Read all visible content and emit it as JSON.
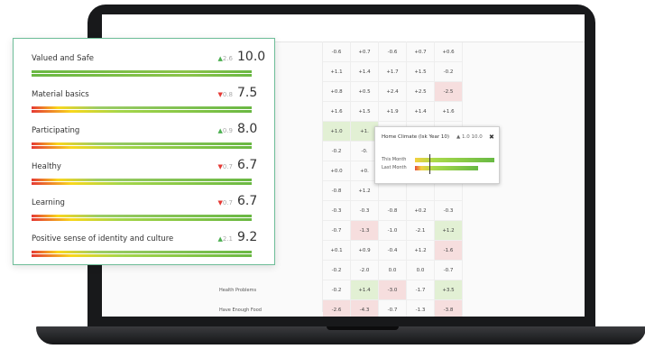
{
  "metrics": [
    {
      "label": "Valued and Safe",
      "direction": "up",
      "delta": "2.6",
      "value": "10.0"
    },
    {
      "label": "Material basics",
      "direction": "down",
      "delta": "0.8",
      "value": "7.5"
    },
    {
      "label": "Participating",
      "direction": "up",
      "delta": "0.9",
      "value": "8.0"
    },
    {
      "label": "Healthy",
      "direction": "down",
      "delta": "0.7",
      "value": "6.7"
    },
    {
      "label": "Learning",
      "direction": "down",
      "delta": "0.7",
      "value": "6.7"
    },
    {
      "label": "Positive sense of identity and culture",
      "direction": "up",
      "delta": "2.1",
      "value": "9.2"
    }
  ],
  "arrows": {
    "up": "▲",
    "down": "▼"
  },
  "colors": {
    "up": "#4caf50",
    "down": "#e53935",
    "accent": "#6ebd98"
  },
  "table": {
    "row_labels": [
      "",
      "",
      "ts at School",
      "",
      "",
      "",
      "",
      "",
      "",
      "",
      "",
      "",
      "Health Problems",
      "Have Enough Food"
    ],
    "rows": [
      [
        "-0.6",
        "+0.7",
        "-0.6",
        "+0.7",
        "+0.6"
      ],
      [
        "+1.1",
        "+1.4",
        "+1.7",
        "+1.5",
        "-0.2"
      ],
      [
        "+0.8",
        "+0.5",
        "+2.4",
        "+2.5",
        "-2.5"
      ],
      [
        "+1.6",
        "+1.5",
        "+1.9",
        "+1.4",
        "+1.6"
      ],
      [
        "+1.0",
        "+1.",
        "",
        "",
        ""
      ],
      [
        "-0.2",
        "-0.",
        "",
        "",
        ""
      ],
      [
        "+0.0",
        "+0.",
        "",
        "",
        ""
      ],
      [
        "-0.8",
        "+1.2",
        "",
        "",
        ""
      ],
      [
        "-0.3",
        "-0.3",
        "-0.8",
        "+0.2",
        "-0.3"
      ],
      [
        "-0.7",
        "-1.3",
        "-1.0",
        "-2.1",
        "+1.2"
      ],
      [
        "+0.1",
        "+0.9",
        "-0.4",
        "+1.2",
        "-1.6"
      ],
      [
        "-0.2",
        "-2.0",
        "0.0",
        "0.0",
        "-0.7"
      ],
      [
        "-0.2",
        "+1.4",
        "-3.0",
        "-1.7",
        "+3.5"
      ],
      [
        "-2.6",
        "-4.3",
        "-0.7",
        "-1.3",
        "-3.8"
      ]
    ],
    "tones": [
      [
        "",
        "",
        "",
        "",
        ""
      ],
      [
        "",
        "",
        "",
        "",
        ""
      ],
      [
        "",
        "",
        "",
        "",
        "neg"
      ],
      [
        "",
        "",
        "",
        "",
        ""
      ],
      [
        "pos",
        "pos",
        "",
        "",
        ""
      ],
      [
        "",
        "",
        "",
        "",
        ""
      ],
      [
        "",
        "",
        "",
        "",
        ""
      ],
      [
        "",
        "",
        "",
        "",
        ""
      ],
      [
        "",
        "",
        "",
        "",
        ""
      ],
      [
        "",
        "neg",
        "",
        "",
        "pos"
      ],
      [
        "",
        "",
        "",
        "",
        "neg"
      ],
      [
        "",
        "",
        "",
        "",
        ""
      ],
      [
        "",
        "pos",
        "neg",
        "",
        "pos"
      ],
      [
        "neg",
        "neg",
        "",
        "",
        "neg"
      ]
    ]
  },
  "tooltip": {
    "title": "Home Climate (Isk Year 10)",
    "stat": "▲ 1.0  10.0",
    "close": "✖",
    "this_month": "This Month",
    "last_month": "Last Month"
  }
}
